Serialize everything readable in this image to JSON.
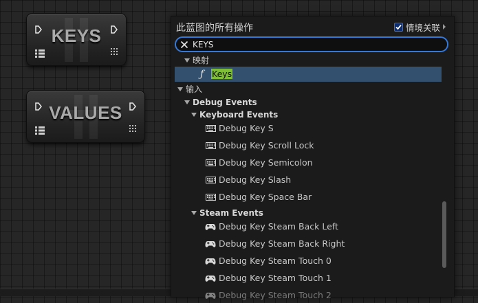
{
  "nodes": {
    "keys": {
      "title": "KEYS"
    },
    "values": {
      "title": "VALUES"
    }
  },
  "menu": {
    "title": "此蓝图的所有操作",
    "context_label": "情境关联",
    "context_checked": true,
    "search_value": "KEYS",
    "categories": {
      "mapping": "映射",
      "input": "输入",
      "debug_events": "Debug Events",
      "keyboard_events": "Keyboard Events",
      "steam_events": "Steam Events"
    },
    "mapping_item": {
      "prefix": "",
      "highlight": "Keys"
    },
    "keyboard_items": [
      "Debug Key S",
      "Debug Key Scroll Lock",
      "Debug Key Semicolon",
      "Debug Key Slash",
      "Debug Key Space Bar"
    ],
    "steam_items": [
      "Debug Key Steam Back Left",
      "Debug Key Steam Back Right",
      "Debug Key Steam Touch 0",
      "Debug Key Steam Touch 1",
      "Debug Key Steam Touch 2"
    ]
  },
  "colors": {
    "selection": "#33506e",
    "highlight": "#7fbc37",
    "search_border": "#3478d8"
  }
}
